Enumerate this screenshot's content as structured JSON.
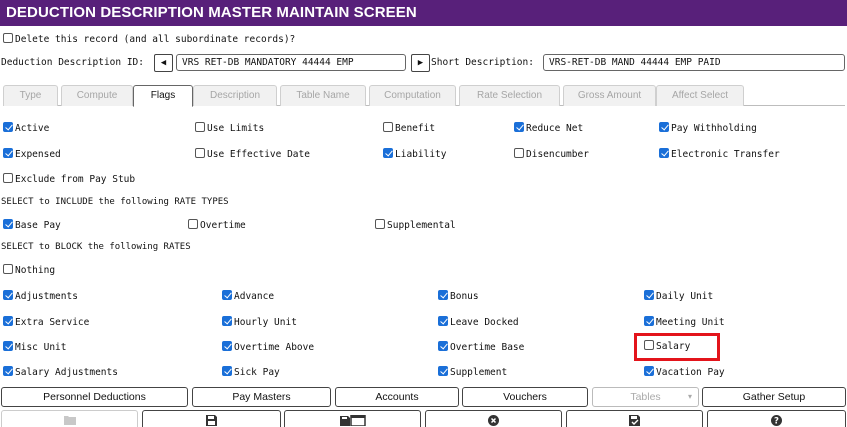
{
  "title": "DEDUCTION DESCRIPTION MASTER MAINTAIN SCREEN",
  "delete_label": "Delete this record (and all subordinate records)?",
  "deduction_id": {
    "label": "Deduction Description ID:",
    "value": "VRS RET-DB MANDATORY 44444   EMP"
  },
  "short_desc": {
    "label": "Short Description:",
    "value": "VRS-RET-DB MAND 44444  EMP PAID"
  },
  "tabs": [
    "Type",
    "Compute",
    "Flags",
    "Description",
    "Table Name",
    "Computation",
    "Rate Selection",
    "Gross Amount",
    "Affect Select"
  ],
  "active_tab": "Flags",
  "flags": {
    "active": "Active",
    "use_limits": "Use Limits",
    "benefit": "Benefit",
    "reduce_net": "Reduce Net",
    "pay_withholding": "Pay Withholding",
    "expensed": "Expensed",
    "use_effective_date": "Use Effective Date",
    "liability": "Liability",
    "disencumber": "Disencumber",
    "electronic_transfer": "Electronic Transfer",
    "exclude_pay_stub": "Exclude from Pay Stub"
  },
  "include_heading": "SELECT to INCLUDE the following RATE TYPES",
  "include": {
    "base_pay": "Base Pay",
    "overtime": "Overtime",
    "supplemental": "Supplemental"
  },
  "block_heading": "SELECT to BLOCK the following RATES",
  "block": {
    "nothing": "Nothing",
    "adjustments": "Adjustments",
    "advance": "Advance",
    "bonus": "Bonus",
    "daily_unit": "Daily Unit",
    "extra_service": "Extra Service",
    "hourly_unit": "Hourly Unit",
    "leave_docked": "Leave Docked",
    "meeting_unit": "Meeting Unit",
    "misc_unit": "Misc Unit",
    "overtime_above": "Overtime Above",
    "overtime_base": "Overtime Base",
    "salary": "Salary",
    "salary_adjustments": "Salary Adjustments",
    "sick_pay": "Sick Pay",
    "supplement": "Supplement",
    "vacation_pay": "Vacation Pay"
  },
  "buttons": {
    "personnel_deductions": "Personnel Deductions",
    "pay_masters": "Pay Masters",
    "accounts": "Accounts",
    "vouchers": "Vouchers",
    "tables": "Tables",
    "gather_setup": "Gather Setup"
  },
  "colors": {
    "title_bar": "#58207a",
    "checkbox_checked": "#1a6fd8",
    "highlight": "#e3141b"
  }
}
